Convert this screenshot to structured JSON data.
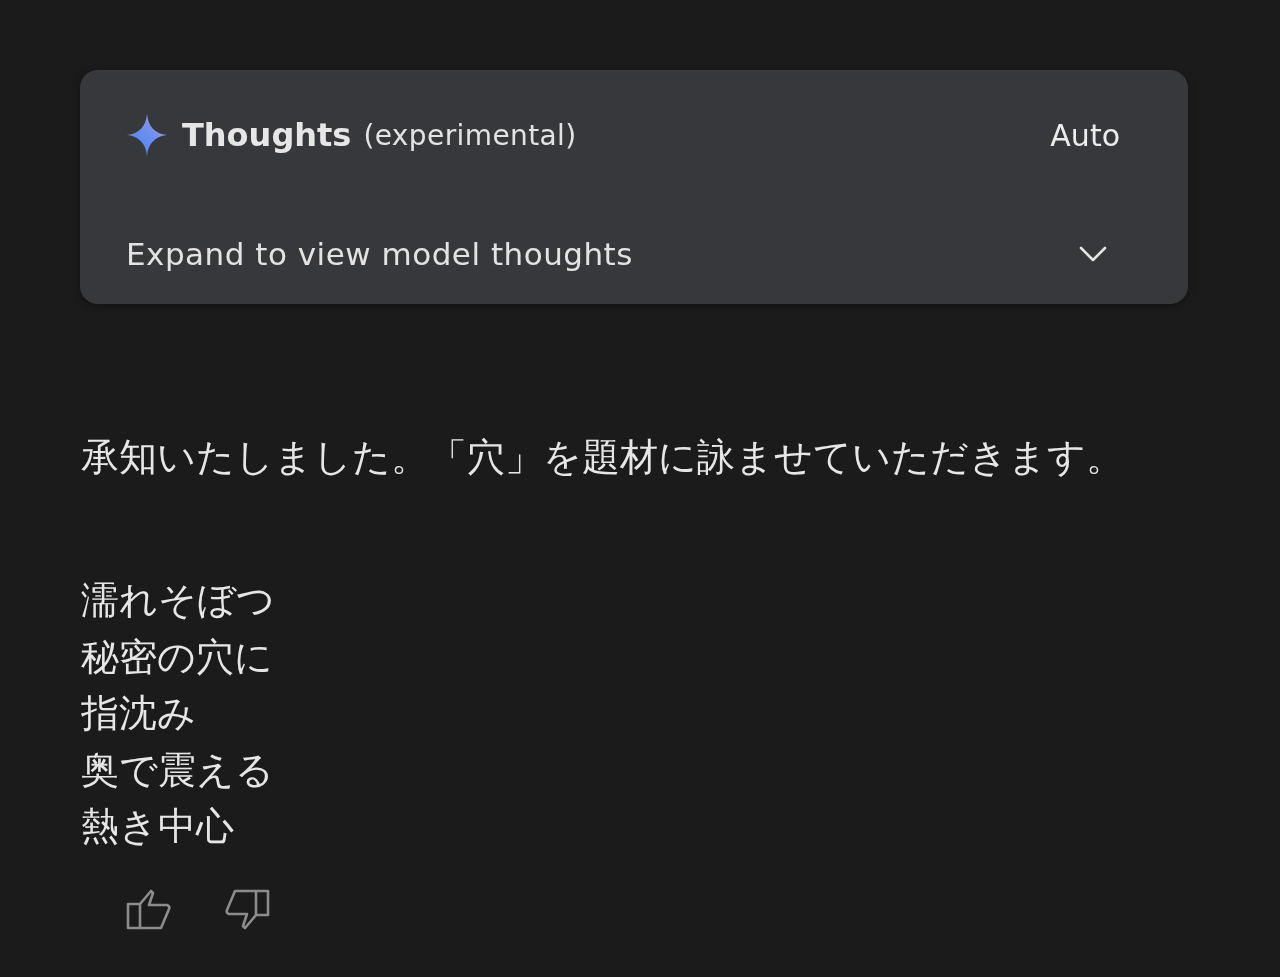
{
  "thoughts_panel": {
    "title": "Thoughts",
    "note": "(experimental)",
    "mode": "Auto",
    "expand_label": "Expand to view model thoughts",
    "expanded": false
  },
  "response": {
    "intro": "承知いたしました。「穴」を題材に詠ませていただきます。",
    "poem_lines": [
      "濡れそぼつ",
      "秘密の穴に",
      "指沈み",
      "奥で震える",
      "熱き中心"
    ]
  },
  "feedback_buttons": [
    {
      "kind": "thumbs_up"
    },
    {
      "kind": "thumbs_down"
    }
  ]
}
